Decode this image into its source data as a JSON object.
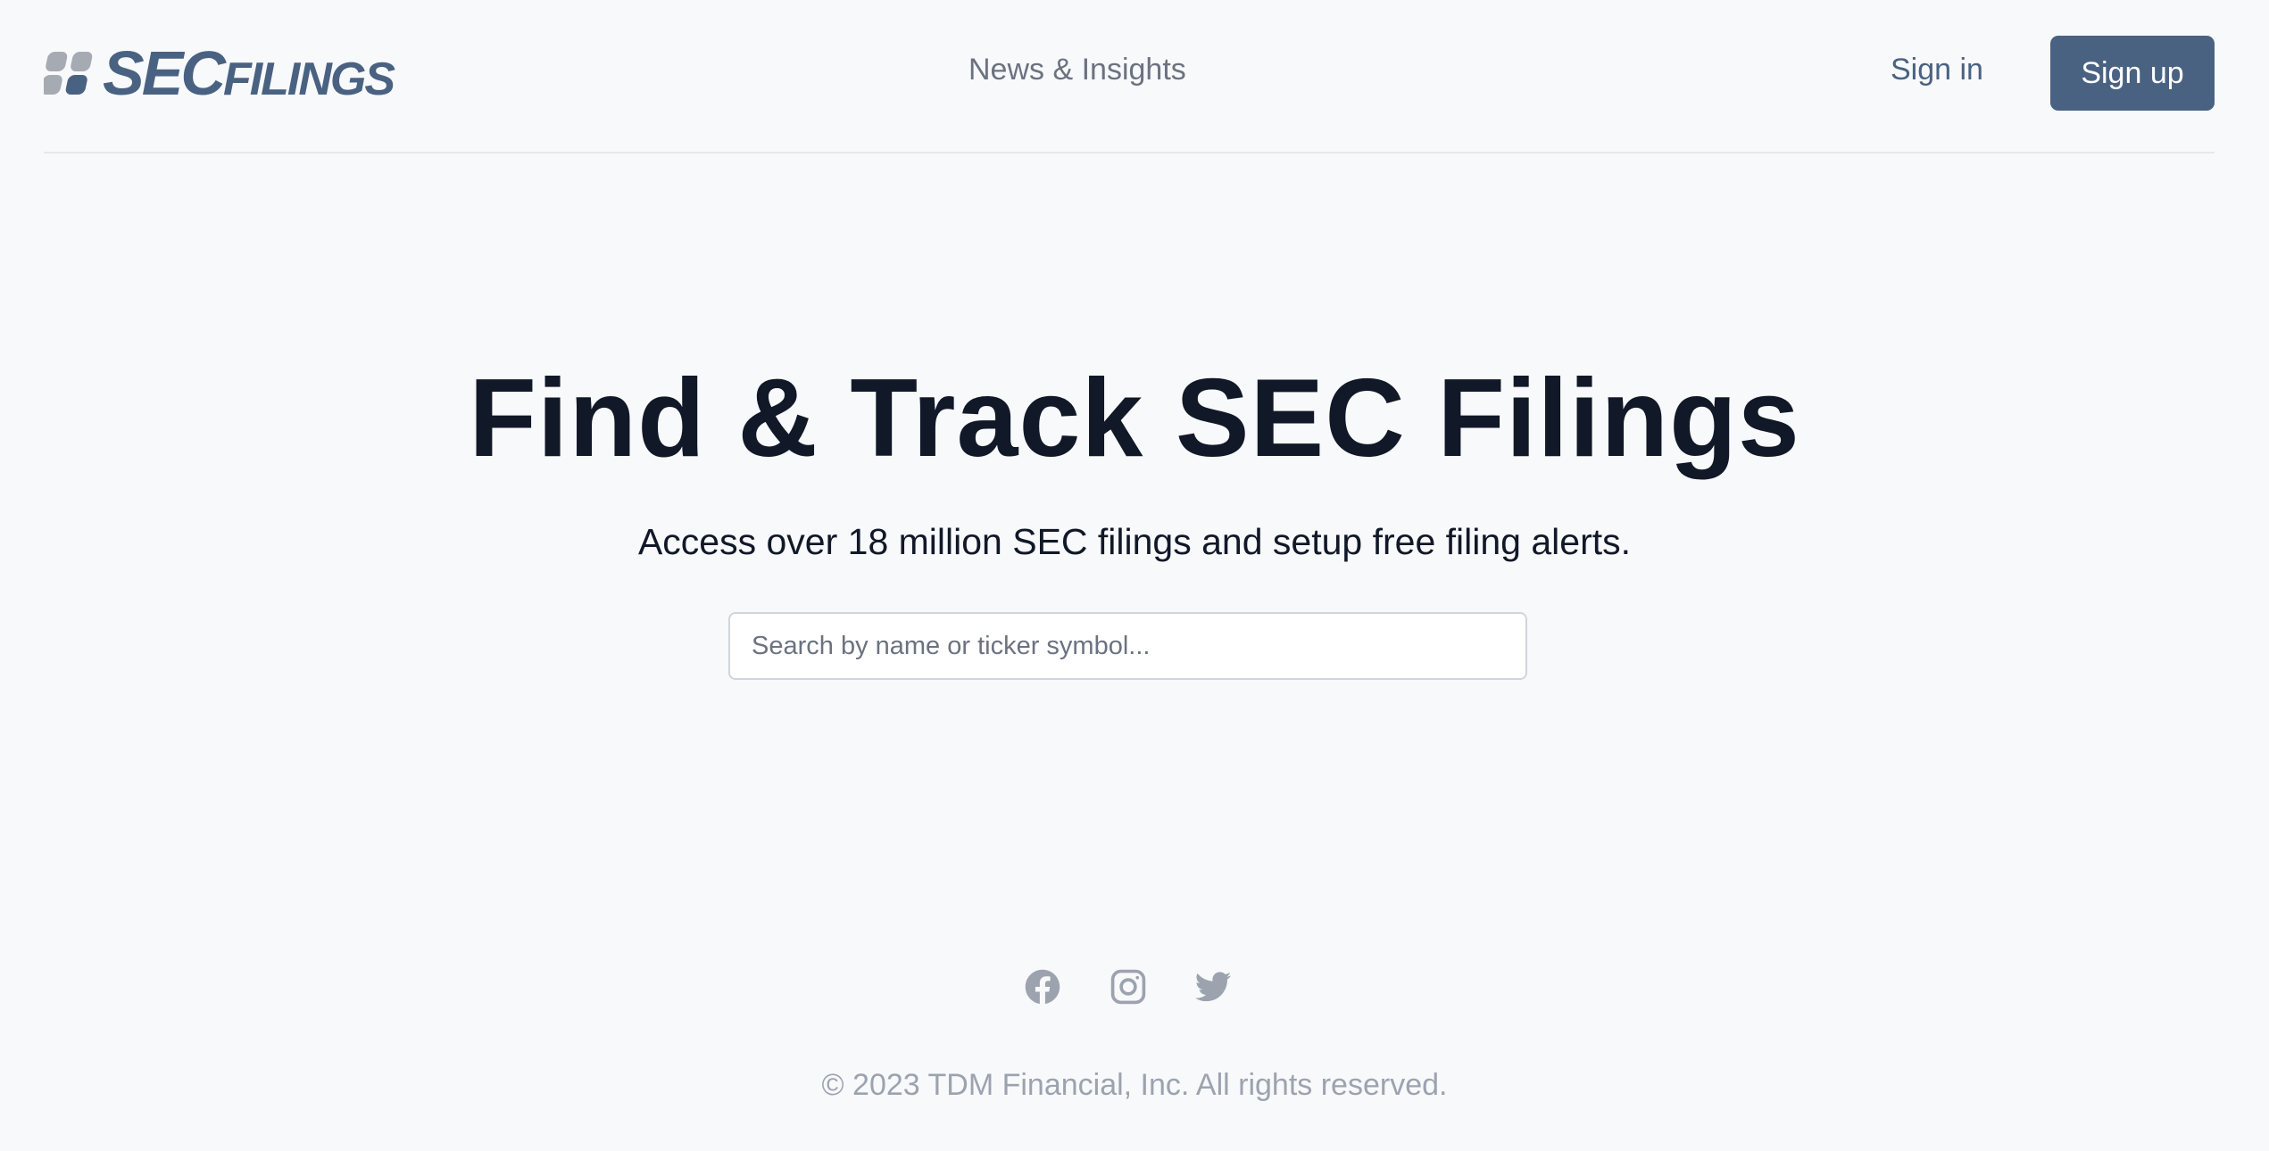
{
  "header": {
    "logo": {
      "sec": "SEC",
      "filings": "FILINGS"
    },
    "nav": {
      "news_label": "News & Insights"
    },
    "signin_label": "Sign in",
    "signup_label": "Sign up"
  },
  "hero": {
    "title": "Find & Track SEC Filings",
    "subtitle": "Access over 18 million SEC filings and setup free filing alerts."
  },
  "search": {
    "placeholder": "Search by name or ticker symbol...",
    "value": ""
  },
  "footer": {
    "social_icons": [
      "facebook-icon",
      "instagram-icon",
      "twitter-icon"
    ],
    "copyright": "© 2023 TDM Financial, Inc. All rights reserved."
  },
  "colors": {
    "brand": "#4a6282",
    "background": "#f8f9fb",
    "heading": "#111827",
    "muted": "#9ca3af",
    "nav": "#6b7280"
  }
}
